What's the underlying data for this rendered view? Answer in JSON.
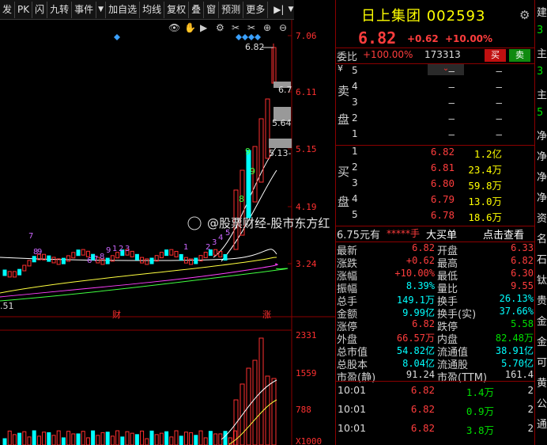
{
  "toolbar": {
    "items": [
      "发",
      "PK",
      "闪",
      "九转",
      "事件",
      "▼",
      "加自选",
      "均线",
      "复权",
      "叠",
      "窗",
      "预测",
      "更多"
    ],
    "right_arrow": "▶|",
    "drop": "▼"
  },
  "chart": {
    "price_labels": [
      "7.06",
      "6.11",
      "5.15",
      "4.19",
      "3.24"
    ],
    "vol_labels": [
      "2331",
      "1559",
      "788",
      "X1000"
    ],
    "high_marker": "6.82",
    "low_marker": ".51",
    "mid_labels": [
      "6.7",
      "5.64",
      "5.13-"
    ],
    "purple_nums": [
      "7",
      "8",
      "9",
      "1",
      "2",
      "3",
      "4",
      "5",
      "6",
      "7",
      "8",
      "9",
      "1",
      "2",
      "3"
    ],
    "green_nums": [
      "9",
      "9",
      "8"
    ],
    "date_labels": [
      "财",
      "涨"
    ],
    "watermark": "@股票财经-股市东方红"
  },
  "quote": {
    "name": "日上集团",
    "code": "002593",
    "price": "6.82",
    "change": "+0.62",
    "pct": "+10.00%",
    "weibi_label": "委比",
    "weibi_val": "+100.00%",
    "weiliang": "173313",
    "buy_btn": "买",
    "sell_btn": "卖",
    "sell_label": "卖盘",
    "buy_label": "买盘",
    "sell_side": "卖\n盘",
    "buy_side": "买\n盘",
    "yen": "¥",
    "sells": [
      {
        "n": "5",
        "p": "–",
        "v": "–"
      },
      {
        "n": "4",
        "p": "–",
        "v": "–"
      },
      {
        "n": "3",
        "p": "–",
        "v": "–"
      },
      {
        "n": "2",
        "p": "–",
        "v": "–"
      },
      {
        "n": "1",
        "p": "–",
        "v": "–"
      }
    ],
    "buys": [
      {
        "n": "1",
        "p": "6.82",
        "v": "1.2亿"
      },
      {
        "n": "2",
        "p": "6.81",
        "v": "23.4万"
      },
      {
        "n": "3",
        "p": "6.80",
        "v": "59.8万"
      },
      {
        "n": "4",
        "p": "6.79",
        "v": "13.0万"
      },
      {
        "n": "5",
        "p": "6.78",
        "v": "18.6万"
      }
    ],
    "tagline": {
      "a": "6.75元有",
      "b": "*****手",
      "c": "大买单",
      "d": "点击查看"
    },
    "stats": [
      [
        "最新",
        "6.82",
        "开盘",
        "6.33"
      ],
      [
        "涨跌",
        "+0.62",
        "最高",
        "6.82"
      ],
      [
        "涨幅",
        "+10.00%",
        "最低",
        "6.30"
      ],
      [
        "振幅",
        "8.39%",
        "量比",
        "9.55"
      ],
      [
        "总手",
        "149.1万",
        "换手",
        "26.13%"
      ],
      [
        "金额",
        "9.99亿",
        "换手(实)",
        "37.66%"
      ],
      [
        "涨停",
        "6.82",
        "跌停",
        "5.58"
      ],
      [
        "外盘",
        "66.57万",
        "内盘",
        "82.48万"
      ],
      [
        "总市值",
        "54.82亿",
        "流通值",
        "38.91亿"
      ],
      [
        "总股本",
        "8.04亿",
        "流通股",
        "5.70亿"
      ],
      [
        "市盈(静)",
        "91.24",
        "市盈(TTM)",
        "161.4"
      ]
    ],
    "ticks": [
      {
        "t": "10:01",
        "p": "6.82",
        "v": "1.4万",
        "x": "2"
      },
      {
        "t": "10:01",
        "p": "6.82",
        "v": "0.9万",
        "x": "2"
      },
      {
        "t": "10:01",
        "p": "6.82",
        "v": "3.8万",
        "x": "2"
      }
    ]
  },
  "edge": [
    "建",
    "3",
    "主",
    "3",
    "主",
    "5",
    "净",
    "净",
    "净",
    "净",
    "资",
    "名",
    "石",
    "钛",
    "贵",
    "金",
    "金",
    "可",
    "黄",
    "公",
    "通"
  ]
}
